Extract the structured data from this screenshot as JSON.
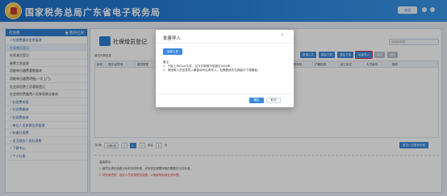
{
  "header": {
    "title": "国家税务总局广东省电子税务局",
    "user_label": "欢迎"
  },
  "sidebar": {
    "head_left": "社保费",
    "head_right": "▣ 我的社保",
    "items": [
      {
        "label": "+ 社保费基本信息管理"
      },
      {
        "label": "社保增员登记"
      },
      {
        "label": "社保减员登记"
      },
      {
        "label": "缴费工资变更"
      },
      {
        "label": "用能单位缴费基数查询"
      },
      {
        "label": "用能单位缴费明细(一次上门)"
      },
      {
        "label": "社会保险费工资基数登记"
      },
      {
        "label": "社会保险费缴费人员参保情况查询"
      },
      {
        "label": "+ 社保费申报"
      },
      {
        "label": "+ 社保费缴纳"
      },
      {
        "label": "+ 社保费查询"
      },
      {
        "label": "+ 单位人员参保信息管理"
      },
      {
        "label": "+ 补缴社保费"
      },
      {
        "label": "+ 灵活就业人员社保费"
      },
      {
        "label": "+ 下载中心"
      },
      {
        "label": "+ 个人社保"
      }
    ]
  },
  "main": {
    "page_title": "社保增员登记",
    "search_placeholder": "请选择类型",
    "sub_label": "增员列表信息",
    "toolbar": [
      {
        "label": "新增人员"
      },
      {
        "label": "模板下载"
      },
      {
        "label": "模板下载"
      },
      {
        "label": "批量导入"
      },
      {
        "label": "修改"
      },
      {
        "label": "删除"
      }
    ],
    "columns": [
      "序号",
      "姓名/证件号",
      "增员类型",
      "证件类型",
      "证件号码",
      "户籍性质",
      "用工形式",
      "人员身份",
      "操作"
    ],
    "pager": {
      "total": "共0条",
      "page_size": "10条/页",
      "prev": "<",
      "current": "1",
      "next": ">",
      "goto": "前往",
      "goto_page": "1",
      "page": "页"
    },
    "add_all_button": "增员人员整体申报",
    "tips_title": "温馨提示：",
    "tips": [
      "1. 增员后请在缴费月份前完成申报，未按规定期限申报的需要在次月补缴。",
      "2. 请在增员前，核实人员信息是否准确，以免影响后续业务办理。"
    ]
  },
  "modal": {
    "title": "批量导入",
    "close": "×",
    "upload_label": "选择上传",
    "notes_title": "备注：",
    "notes": [
      "1、只能上传Excel文件，且文件数据不能超过5000条。",
      "2、请按照人员信息导入模板填写后再导入，如需要请先在弹窗中下载模板。"
    ],
    "ok_label": "确定",
    "cancel_label": "取消"
  },
  "colors": {
    "header": "#2b85df",
    "accent": "#3b8ae0",
    "highlight": "#e53935"
  }
}
